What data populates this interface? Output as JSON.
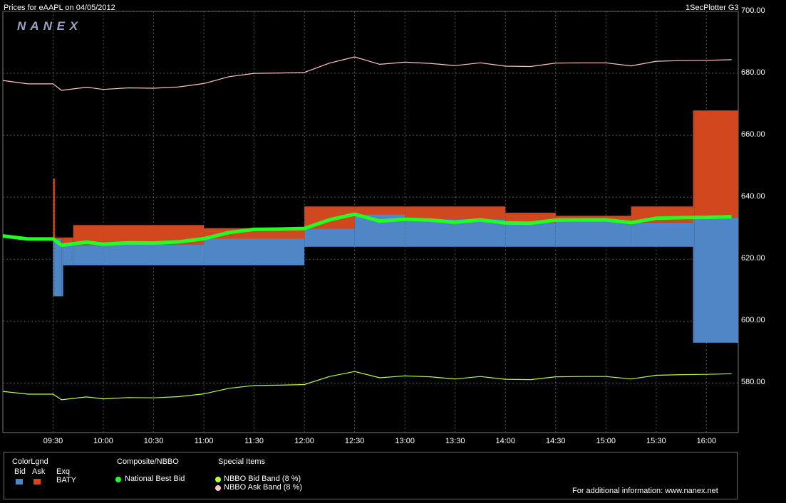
{
  "header": {
    "title_left": "Prices for  eAAPL  on  04/05/2012",
    "title_right": "1SecPlotter G3",
    "logo": "N A N E X"
  },
  "colors": {
    "plot_bg": "#000000",
    "grid": "#555555",
    "bid": "#4f86c6",
    "ask": "#d2481e",
    "nbb": "#22ff22",
    "bid_band": "#b8ff3a",
    "ask_band": "#ffc6c6"
  },
  "legend": {
    "color_legend_title": "ColorLgnd",
    "bid_label": "Bid",
    "ask_label": "Ask",
    "exq_label": "Exq",
    "exchange": "BATY",
    "composite_title": "Composite/NBBO",
    "nbb_label": "National Best Bid",
    "special_title": "Special Items",
    "bid_band_label": "NBBO Bid Band (8 %)",
    "ask_band_label": "NBBO Ask Band (8 %)",
    "info": "For additional information: www.nanex.net"
  },
  "chart_data": {
    "type": "line",
    "title": "Prices for  eAAPL  on  04/05/2012",
    "xlabel": "",
    "ylabel": "",
    "ylim": [
      564,
      700
    ],
    "xlim": [
      "09:00",
      "16:19"
    ],
    "grid": true,
    "x_ticks": [
      "09:30",
      "10:00",
      "10:30",
      "11:00",
      "11:30",
      "12:00",
      "12:30",
      "13:00",
      "13:30",
      "14:00",
      "14:30",
      "15:00",
      "15:30",
      "16:00"
    ],
    "y_ticks": [
      "700.00",
      "680.00",
      "660.00",
      "640.00",
      "620.00",
      "600.00",
      "580.00"
    ],
    "series": [
      {
        "name": "National Best Bid",
        "x": [
          "09:00",
          "09:15",
          "09:30",
          "09:35",
          "09:50",
          "10:00",
          "10:15",
          "10:30",
          "10:45",
          "11:00",
          "11:15",
          "11:30",
          "11:45",
          "12:00",
          "12:15",
          "12:30",
          "12:45",
          "13:00",
          "13:15",
          "13:30",
          "13:45",
          "14:00",
          "14:15",
          "14:30",
          "14:45",
          "15:00",
          "15:15",
          "15:30",
          "15:45",
          "16:00",
          "16:15"
        ],
        "values": [
          627.5,
          626.5,
          626.5,
          624.5,
          625.5,
          624.8,
          625.3,
          625.2,
          625.6,
          626.6,
          628.6,
          629.6,
          629.7,
          629.9,
          632.7,
          634.5,
          632.3,
          632.9,
          632.6,
          631.9,
          632.7,
          631.7,
          631.6,
          632.6,
          632.7,
          632.7,
          631.8,
          633.2,
          633.4,
          633.5,
          633.7
        ]
      },
      {
        "name": "NBBO Bid Band (8 %)",
        "x": [
          "09:00",
          "09:15",
          "09:30",
          "09:35",
          "09:50",
          "10:00",
          "10:15",
          "10:30",
          "10:45",
          "11:00",
          "11:15",
          "11:30",
          "11:45",
          "12:00",
          "12:15",
          "12:30",
          "12:45",
          "13:00",
          "13:15",
          "13:30",
          "13:45",
          "14:00",
          "14:15",
          "14:30",
          "14:45",
          "15:00",
          "15:15",
          "15:30",
          "15:45",
          "16:00",
          "16:15"
        ],
        "values": [
          577.3,
          576.4,
          576.4,
          574.6,
          575.5,
          574.9,
          575.3,
          575.2,
          575.6,
          576.5,
          578.3,
          579.2,
          579.3,
          579.5,
          582.1,
          583.7,
          581.7,
          582.3,
          582.0,
          581.3,
          582.1,
          581.2,
          581.1,
          582.0,
          582.1,
          582.1,
          581.3,
          582.5,
          582.7,
          582.8,
          583.0
        ]
      },
      {
        "name": "NBBO Ask Band (8 %)",
        "x": [
          "09:00",
          "09:15",
          "09:30",
          "09:35",
          "09:50",
          "10:00",
          "10:15",
          "10:30",
          "10:45",
          "11:00",
          "11:15",
          "11:30",
          "11:45",
          "12:00",
          "12:15",
          "12:30",
          "12:45",
          "13:00",
          "13:15",
          "13:30",
          "13:45",
          "14:00",
          "14:15",
          "14:30",
          "14:45",
          "15:00",
          "15:15",
          "15:30",
          "15:45",
          "16:00",
          "16:15"
        ],
        "values": [
          677.7,
          676.6,
          676.6,
          674.5,
          675.5,
          674.8,
          675.3,
          675.2,
          675.6,
          676.7,
          678.9,
          680.0,
          680.1,
          680.3,
          683.3,
          685.3,
          682.9,
          683.6,
          683.2,
          682.5,
          683.4,
          682.3,
          682.2,
          683.3,
          683.4,
          683.4,
          682.4,
          683.9,
          684.1,
          684.2,
          684.4
        ]
      }
    ],
    "exchange_quotes": {
      "exchange": "BATY",
      "segments": [
        {
          "start": "09:30",
          "end": "09:31",
          "bid": 608,
          "ask": 646
        },
        {
          "start": "09:31",
          "end": "09:35",
          "bid": 608,
          "ask": 627
        },
        {
          "start": "09:35",
          "end": "09:36",
          "bid": 608,
          "ask": 627
        },
        {
          "start": "09:36",
          "end": "09:42",
          "bid": 618,
          "ask": 627
        },
        {
          "start": "09:42",
          "end": "10:00",
          "bid": 618,
          "ask": 631
        },
        {
          "start": "10:00",
          "end": "11:00",
          "bid": 618,
          "ask": 631
        },
        {
          "start": "11:00",
          "end": "12:00",
          "bid": 618,
          "ask": 630
        },
        {
          "start": "12:00",
          "end": "12:30",
          "bid": 624,
          "ask": 637
        },
        {
          "start": "12:30",
          "end": "13:00",
          "bid": 624,
          "ask": 637
        },
        {
          "start": "13:00",
          "end": "14:00",
          "bid": 624,
          "ask": 637
        },
        {
          "start": "14:00",
          "end": "14:30",
          "bid": 624,
          "ask": 635
        },
        {
          "start": "14:30",
          "end": "15:15",
          "bid": 624,
          "ask": 634
        },
        {
          "start": "15:15",
          "end": "15:52",
          "bid": 624,
          "ask": 637
        },
        {
          "start": "15:52",
          "end": "15:53",
          "bid": 593,
          "ask": 668
        },
        {
          "start": "15:53",
          "end": "16:19",
          "bid": 593,
          "ask": 668
        }
      ]
    }
  }
}
